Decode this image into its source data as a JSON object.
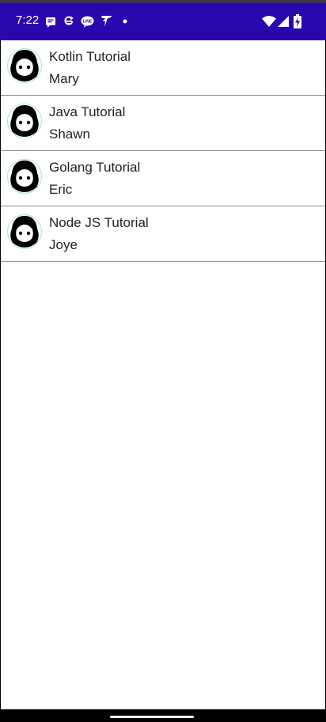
{
  "status_bar": {
    "time": "7:22",
    "background": "#2a07ad",
    "left_icons": [
      "message-notification-icon",
      "sync-notification-icon",
      "line-app-icon",
      "bolt-notification-icon",
      "more-notifications-dot-icon"
    ],
    "right_icons": [
      "wifi-icon",
      "cellular-signal-icon",
      "battery-charging-icon"
    ]
  },
  "list": {
    "items": [
      {
        "title": "Kotlin Tutorial",
        "subtitle": "Mary",
        "avatar_icon": "avatar-icon"
      },
      {
        "title": "Java Tutorial",
        "subtitle": "Shawn",
        "avatar_icon": "avatar-icon"
      },
      {
        "title": "Golang Tutorial",
        "subtitle": "Eric",
        "avatar_icon": "avatar-icon"
      },
      {
        "title": "Node JS Tutorial",
        "subtitle": "Joye",
        "avatar_icon": "avatar-icon"
      }
    ]
  },
  "navigation": {
    "handle_icon": "home-gesture-handle"
  }
}
